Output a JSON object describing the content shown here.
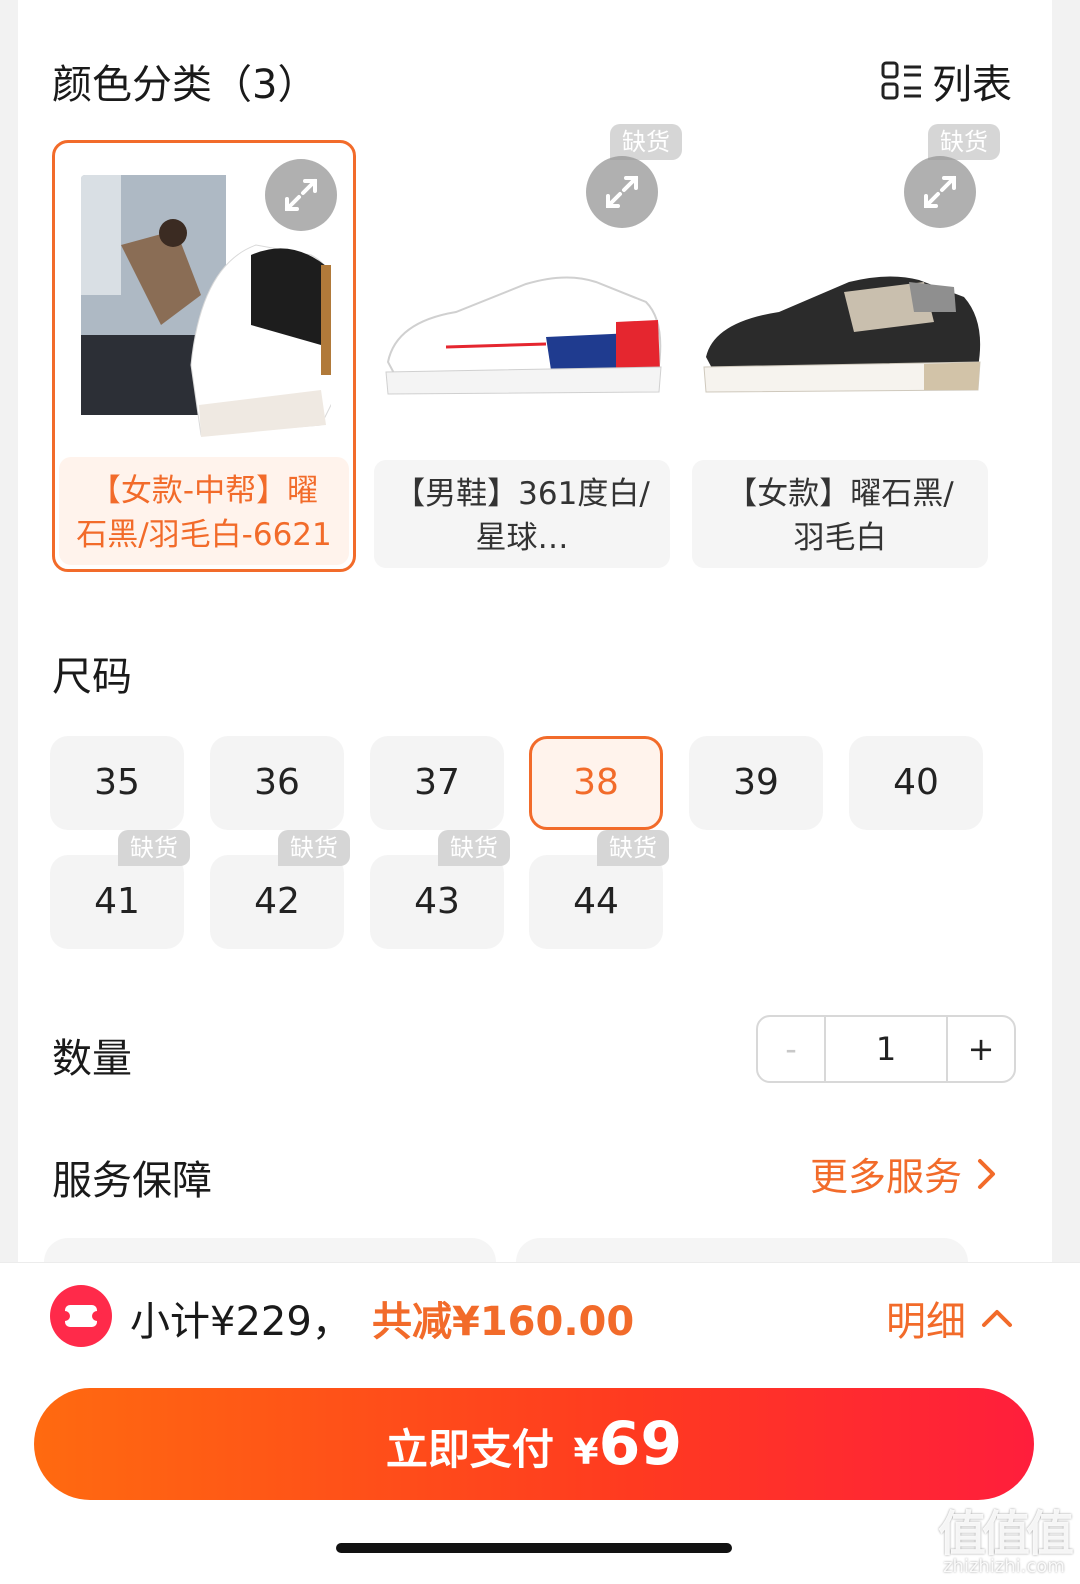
{
  "color_section": {
    "title": "颜色分类（3）",
    "list_toggle": "列表",
    "items": [
      {
        "label_line1": "【女款-中帮】曜",
        "label_line2": "石黑/羽毛白-6621",
        "selected": true,
        "out_of_stock": false
      },
      {
        "label_line1": "【男鞋】361度白/",
        "label_line2": "星球…",
        "selected": false,
        "out_of_stock": true
      },
      {
        "label_line1": "【女款】曜石黑/",
        "label_line2": "羽毛白",
        "selected": false,
        "out_of_stock": true
      }
    ],
    "out_of_stock_tag": "缺货"
  },
  "size_section": {
    "title": "尺码",
    "sizes": [
      "35",
      "36",
      "37",
      "38",
      "39",
      "40",
      "41",
      "42",
      "43",
      "44"
    ],
    "selected": "38",
    "out_tag": "缺货"
  },
  "quantity_section": {
    "title": "数量",
    "minus": "-",
    "value": "1",
    "plus": "+"
  },
  "service_section": {
    "title": "服务保障",
    "more": "更多服务"
  },
  "footer": {
    "subtotal": "小计¥229，",
    "discount": "共减¥160.00",
    "detail": "明细",
    "pay_label": "立即支付",
    "pay_currency": "¥",
    "pay_amount": "69"
  },
  "watermark": {
    "logo_text": "值值值",
    "domain": "zhizhizhi.com"
  },
  "colors": {
    "accent": "#f26b2a",
    "pay_start": "#ff6a10",
    "pay_end": "#ff1e3c",
    "tag_gray": "#d6d6d6"
  }
}
